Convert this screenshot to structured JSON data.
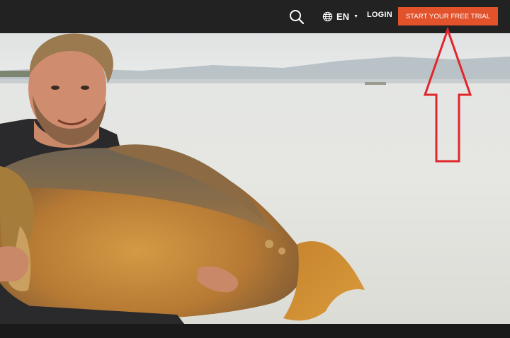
{
  "header": {
    "language_label": "EN",
    "login_label": "LOGIN",
    "cta_label": "START YOUR FREE TRIAL"
  },
  "icons": {
    "search": "search-icon",
    "globe": "globe-icon",
    "caret": "caret-down-icon"
  },
  "colors": {
    "header_bg": "#222222",
    "cta_bg": "#e2532c",
    "annotation_arrow": "#e0262c"
  }
}
